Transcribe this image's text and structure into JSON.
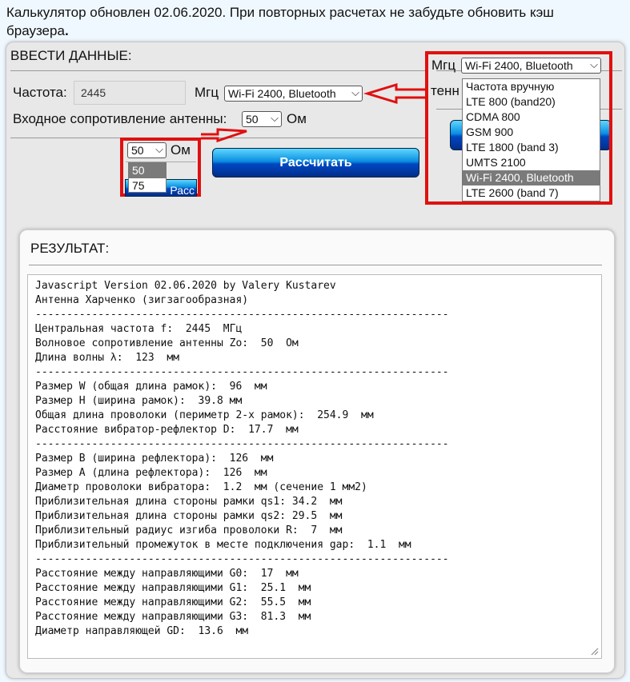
{
  "notice": {
    "text": "Калькулятор обновлен  02.06.2020. При повторных расчетах не забудьте обновить кэш браузера",
    "dot": "."
  },
  "input_panel": {
    "title": "ВВЕСТИ ДАННЫЕ:",
    "freq_label": "Частота:",
    "freq_value": "2445",
    "freq_unit": "Мгц",
    "band_selected": "Wi-Fi 2400, Bluetooth",
    "impedance_label": "Входное сопротивление антенны:",
    "impedance_value": "50",
    "impedance_unit": "Ом",
    "calc_button": "Рассчитать"
  },
  "zoom_impedance": {
    "selected": "50",
    "unit": "Ом",
    "options": [
      "50",
      "75"
    ],
    "button_fragment": "Расс"
  },
  "zoom_band": {
    "unit": "Мгц",
    "selected": "Wi-Fi 2400, Bluetooth",
    "behind_text": "тенн",
    "options": [
      "Частота вручную",
      "LTE 800 (band20)",
      "CDMA 800",
      "GSM 900",
      "LTE 1800 (band 3)",
      "UMTS 2100",
      "Wi-Fi 2400, Bluetooth",
      "LTE 2600 (band 7)"
    ]
  },
  "result": {
    "title": "РЕЗУЛЬТАТ:",
    "lines": [
      "Javascript Version 02.06.2020 by Valery Kustarev",
      "Антенна Харченко (зигзагообразная)",
      "------------------------------------------------------------------",
      "Центральная частота f:  2445  МГц",
      "Волновое сопротивление антенны Zo:  50  Ом",
      "Длина волны λ:  123  мм",
      "------------------------------------------------------------------",
      "Размер W (общая длина рамок):  96  мм",
      "Размер H (ширина рамок):  39.8 мм",
      "Общая длина проволоки (периметр 2-х рамок):  254.9  мм",
      "Расстояние вибратор-рефлектор D:  17.7  мм",
      "------------------------------------------------------------------",
      "Размер B (ширина рефлектора):  126  мм",
      "Размер A (длина рефлектора):  126  мм",
      "Диаметр проволоки вибратора:  1.2  мм (сечение 1 мм2)",
      "Приблизительная длина стороны рамки qs1: 34.2  мм",
      "Приблизительная длина стороны рамки qs2: 29.5  мм",
      "Приблизительный радиус изгиба проволоки R:  7  мм",
      "Приблизительный промежуток в месте подключения gap:  1.1  мм",
      "------------------------------------------------------------------",
      "Расстояние между направляющими G0:  17  мм",
      "Расстояние между направляющими G1:  25.1  мм",
      "Расстояние между направляющими G2:  55.5  мм",
      "Расстояние между направляющими G3:  81.3  мм",
      "Диаметр направляющей GD:  13.6  мм"
    ]
  },
  "colors": {
    "page_bg": "#f0f8ff",
    "annotation_red": "#e01010",
    "button_blue": "#0047c2",
    "selected_option_bg": "#7a7a7a"
  }
}
